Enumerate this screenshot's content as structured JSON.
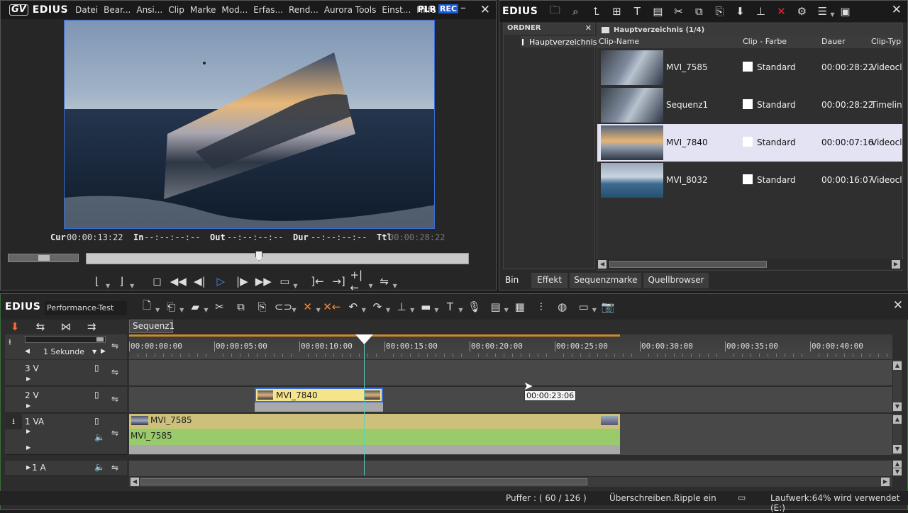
{
  "player": {
    "logo_badge": "GV",
    "logo": "EDIUS",
    "menu": [
      "Datei",
      "Bear...",
      "Ansi...",
      "Clip",
      "Marke",
      "Mod...",
      "Erfas...",
      "Rend...",
      "Aurora Tools",
      "Einst...",
      "Hilfe"
    ],
    "plr": "PLR",
    "rec": "REC",
    "cur_label": "Cur",
    "cur_value": "00:00:13:22",
    "in_label": "In",
    "in_value": "--:--:--:--",
    "out_label": "Out",
    "out_value": "--:--:--:--",
    "dur_label": "Dur",
    "dur_value": "--:--:--:--",
    "ttl_label": "Ttl",
    "ttl_value": "00:00:28:22",
    "scrub_position": 0.45
  },
  "bin": {
    "logo": "EDIUS",
    "folder_header": "ORDNER",
    "folder_item": "Hauptverzeichnis",
    "path_title": "Hauptverzeichnis (1/4)",
    "columns": [
      "Clip-Name",
      "Clip - Farbe",
      "Dauer",
      "Clip-Typ"
    ],
    "clips": [
      {
        "name": "MVI_7585",
        "color": "Standard",
        "duration": "00:00:28:22",
        "type": "Videoclip",
        "thumb": "deck"
      },
      {
        "name": "Sequenz1",
        "color": "Standard",
        "duration": "00:00:28:22",
        "type": "Timeline-S",
        "thumb": "deck"
      },
      {
        "name": "MVI_7840",
        "color": "Standard",
        "duration": "00:00:07:16",
        "type": "Videoclip",
        "thumb": "sunset"
      },
      {
        "name": "MVI_8032",
        "color": "Standard",
        "duration": "00:00:16:07",
        "type": "Videoclip",
        "thumb": "ice"
      }
    ],
    "selected_index": 2,
    "tabs": [
      "Bin",
      "Effekt",
      "Sequenzmarke",
      "Quellbrowser"
    ],
    "active_tab": 0
  },
  "timeline": {
    "logo": "EDIUS",
    "project": "Performance-Test",
    "sequence_tab": "Sequenz1",
    "zoom": "1 Sekunde",
    "ruler": [
      "00:00:00:00",
      "00:00:05:00",
      "00:00:10:00",
      "00:00:15:00",
      "00:00:20:00",
      "00:00:25:00",
      "00:00:30:00",
      "00:00:35:00",
      "00:00:40:00"
    ],
    "tracks": {
      "v3": "3 V",
      "v2": "2 V",
      "va1": "1 VA",
      "a1": "1 A"
    },
    "clip_v2": "MVI_7840",
    "clip_va_video": "MVI_7585",
    "clip_va_audio": "MVI_7585",
    "tooltip": "00:00:23:06",
    "accent_green": "#9acb6a",
    "accent_yellow": "#f5e48a"
  },
  "status": {
    "buffer": "Puffer : ( 60 / 126 )",
    "mode": "Überschreiben...",
    "ripple": "Ripple ein",
    "drive": "Laufwerk:64% wird verwendet (E:)"
  }
}
